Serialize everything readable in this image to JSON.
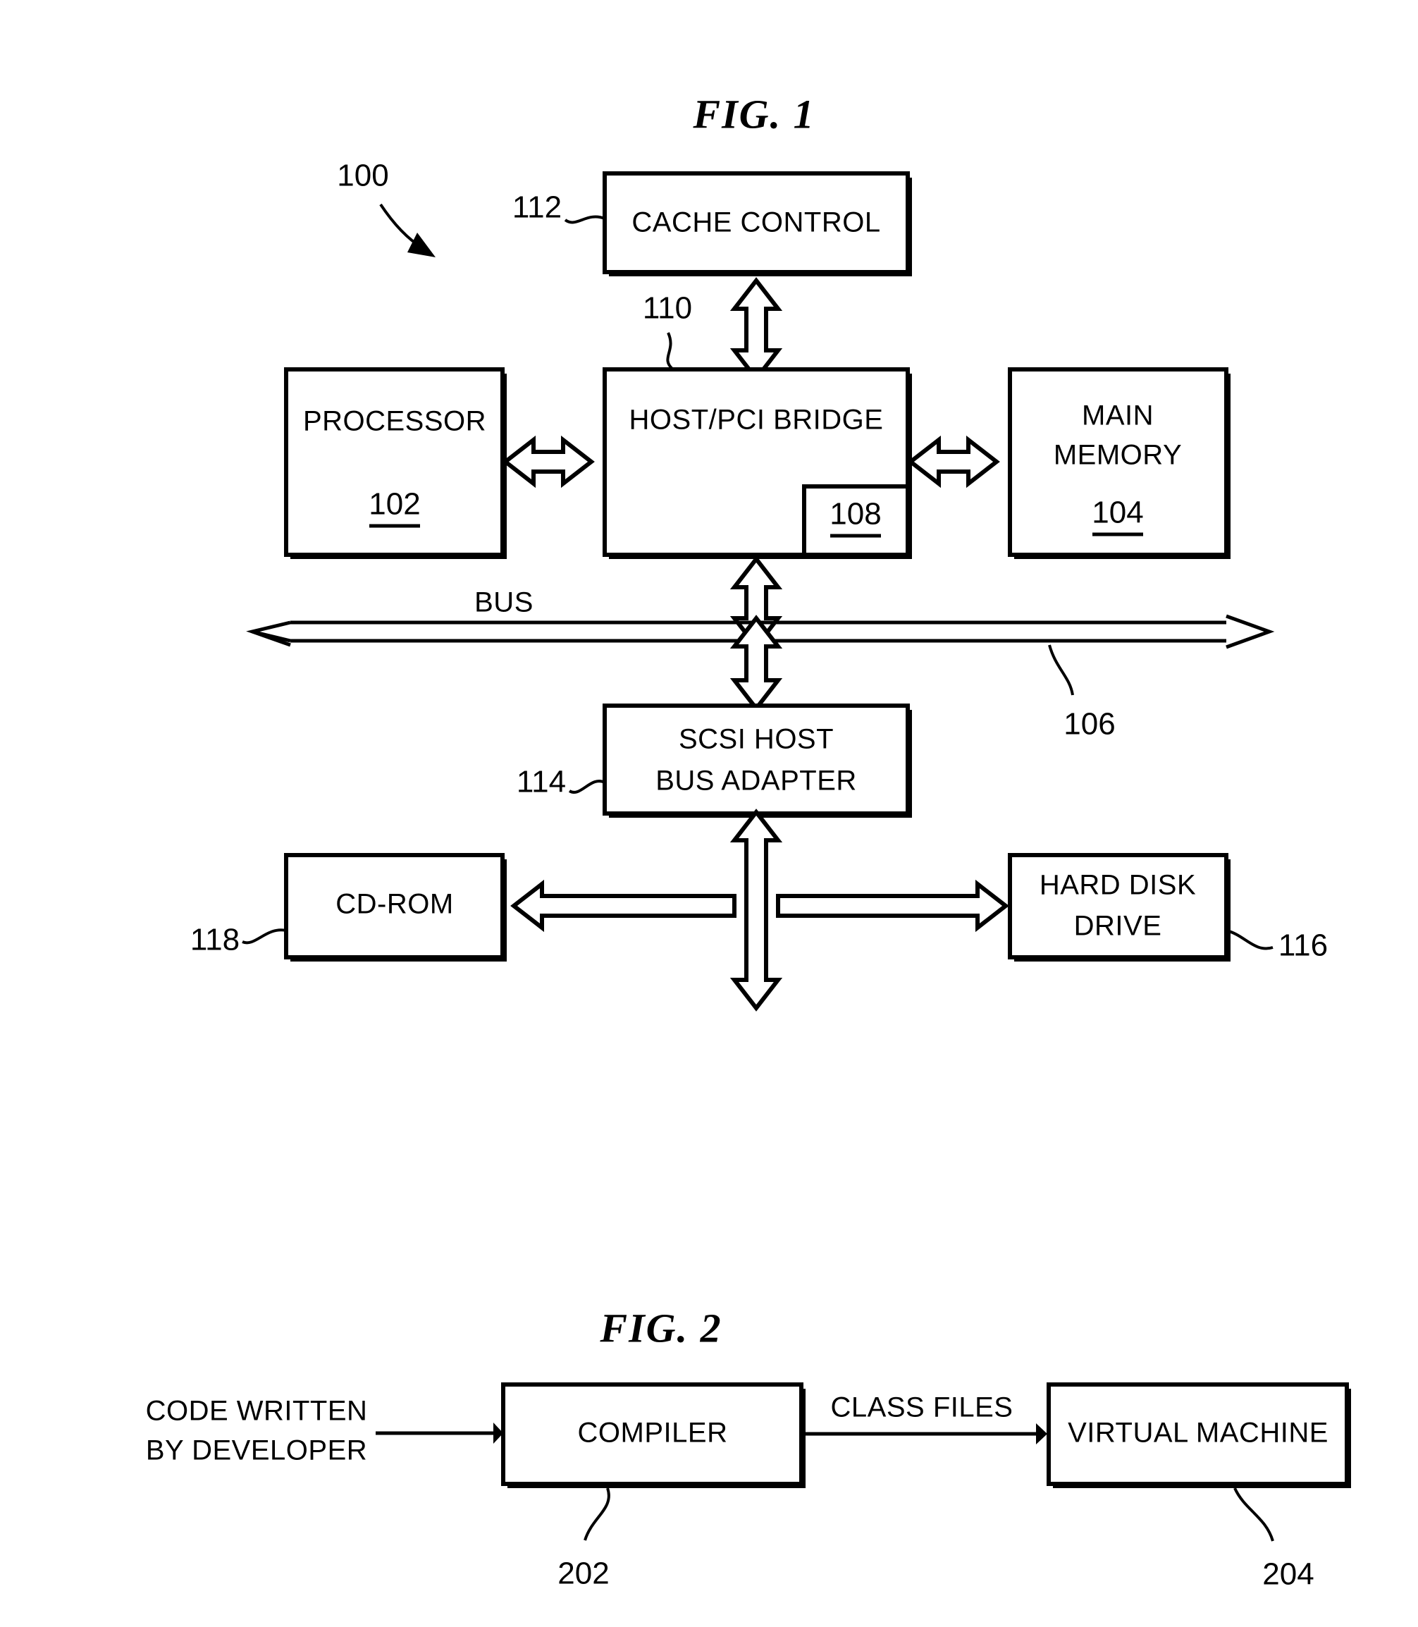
{
  "figures": [
    {
      "id": "fig1",
      "title": "FIG. 1",
      "system_ref": "100",
      "blocks": [
        {
          "key": "cache_control",
          "label": "CACHE CONTROL",
          "ref": "112",
          "ref_position": "left-outside"
        },
        {
          "key": "host_pci_bridge",
          "label": "HOST/PCI BRIDGE",
          "ref": "110",
          "ref_position": "top-left-outside",
          "inner_ref": "108"
        },
        {
          "key": "processor",
          "label": "PROCESSOR",
          "inner_ref": "102"
        },
        {
          "key": "main_memory",
          "label_line1": "MAIN",
          "label_line2": "MEMORY",
          "inner_ref": "104"
        },
        {
          "key": "scsi_host_bus_adapter",
          "label_line1": "SCSI HOST",
          "label_line2": "BUS ADAPTER",
          "ref": "114",
          "ref_position": "left-outside"
        },
        {
          "key": "cd_rom",
          "label": "CD-ROM",
          "ref": "118",
          "ref_position": "left-outside"
        },
        {
          "key": "hard_disk_drive",
          "label_line1": "HARD DISK",
          "label_line2": "DRIVE",
          "ref": "116",
          "ref_position": "right-outside"
        }
      ],
      "bus": {
        "label": "BUS",
        "ref": "106"
      }
    },
    {
      "id": "fig2",
      "title": "FIG. 2",
      "input_label_line1": "CODE WRITTEN",
      "input_label_line2": "BY DEVELOPER",
      "edge_label": "CLASS FILES",
      "blocks": [
        {
          "key": "compiler",
          "label": "COMPILER",
          "ref": "202",
          "ref_position": "below"
        },
        {
          "key": "virtual_machine",
          "label": "VIRTUAL MACHINE",
          "ref": "204",
          "ref_position": "below-right"
        }
      ]
    }
  ],
  "colors": {
    "ink": "#000000",
    "paper": "#ffffff"
  }
}
